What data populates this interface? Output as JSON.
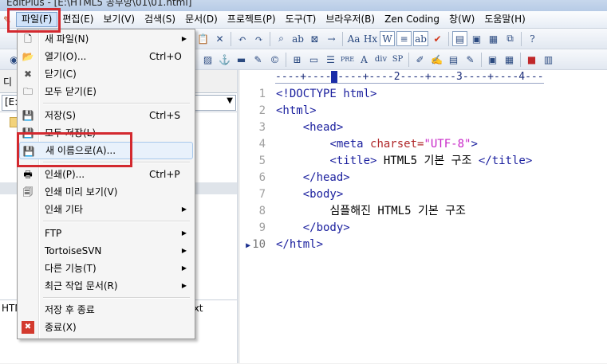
{
  "titlebar": {
    "text": "EditPlus - [E:\\HTML5 공부방\\01\\01.html]"
  },
  "menubar": {
    "items": [
      "파일(F)",
      "편집(E)",
      "보기(V)",
      "검색(S)",
      "문서(D)",
      "프로젝트(P)",
      "도구(T)",
      "브라우저(B)",
      "Zen Coding",
      "창(W)",
      "도움말(H)"
    ]
  },
  "left_panel": {
    "tab_label": "디",
    "drive": "[E:]",
    "file_left": "HTM",
    "file_right": "txt"
  },
  "editor": {
    "ruler": "----+----1----+----2----+----3----+----4---",
    "line_numbers": [
      "1",
      "2",
      "3",
      "4",
      "5",
      "6",
      "7",
      "8",
      "9",
      "10"
    ],
    "lines": [
      [
        {
          "c": "tag",
          "t": "<!DOCTYPE html>"
        }
      ],
      [
        {
          "c": "tag",
          "t": "<html>"
        }
      ],
      [
        {
          "c": "txt",
          "t": "    "
        },
        {
          "c": "tag",
          "t": "<head>"
        }
      ],
      [
        {
          "c": "txt",
          "t": "        "
        },
        {
          "c": "tag",
          "t": "<meta "
        },
        {
          "c": "attr",
          "t": "charset="
        },
        {
          "c": "str",
          "t": "\"UTF-8\""
        },
        {
          "c": "tag",
          "t": ">"
        }
      ],
      [
        {
          "c": "txt",
          "t": "        "
        },
        {
          "c": "tag",
          "t": "<title>"
        },
        {
          "c": "txt",
          "t": " HTML5 기본 구조 "
        },
        {
          "c": "tag",
          "t": "</title>"
        }
      ],
      [
        {
          "c": "txt",
          "t": "    "
        },
        {
          "c": "tag",
          "t": "</head>"
        }
      ],
      [
        {
          "c": "txt",
          "t": "    "
        },
        {
          "c": "tag",
          "t": "<body>"
        }
      ],
      [
        {
          "c": "txt",
          "t": "        심플해진 HTML5 기본 구조"
        }
      ],
      [
        {
          "c": "txt",
          "t": "    "
        },
        {
          "c": "tag",
          "t": "</body>"
        }
      ],
      [
        {
          "c": "tag",
          "t": "</html>"
        }
      ]
    ]
  },
  "file_menu": {
    "items": [
      {
        "label": "새 파일(N)",
        "shortcut": "",
        "submenu": true,
        "icon": "new-file-icon"
      },
      {
        "label": "열기(O)...",
        "shortcut": "Ctrl+O",
        "submenu": false,
        "icon": "open-folder-icon"
      },
      {
        "label": "닫기(C)",
        "shortcut": "",
        "submenu": false,
        "icon": "close-x-icon"
      },
      {
        "label": "모두 닫기(E)",
        "shortcut": "",
        "submenu": false,
        "icon": "close-all-icon"
      },
      {
        "label": "저장(S)",
        "shortcut": "Ctrl+S",
        "submenu": false,
        "icon": "save-disk-icon"
      },
      {
        "label": "모두 저장(L)",
        "shortcut": "",
        "submenu": false,
        "icon": "save-all-icon"
      },
      {
        "label": "새 이름으로(A)...",
        "shortcut": "",
        "submenu": false,
        "icon": "save-as-icon"
      },
      {
        "label": "인쇄(P)...",
        "shortcut": "Ctrl+P",
        "submenu": false,
        "icon": "printer-icon"
      },
      {
        "label": "인쇄 미리 보기(V)",
        "shortcut": "",
        "submenu": false,
        "icon": "print-preview-icon"
      },
      {
        "label": "인쇄 기타",
        "shortcut": "",
        "submenu": true,
        "icon": ""
      },
      {
        "label": "FTP",
        "shortcut": "",
        "submenu": true,
        "icon": ""
      },
      {
        "label": "TortoiseSVN",
        "shortcut": "",
        "submenu": true,
        "icon": ""
      },
      {
        "label": "다른 기능(T)",
        "shortcut": "",
        "submenu": true,
        "icon": ""
      },
      {
        "label": "최근 작업 문서(R)",
        "shortcut": "",
        "submenu": true,
        "icon": ""
      },
      {
        "label": "저장 후 종료",
        "shortcut": "",
        "submenu": false,
        "icon": ""
      },
      {
        "label": "종료(X)",
        "shortcut": "",
        "submenu": false,
        "icon": "exit-icon"
      }
    ]
  },
  "colors": {
    "highlight": "#d3292f",
    "tag": "#1a1f9e",
    "attribute": "#b0282a",
    "string": "#c826c8"
  }
}
